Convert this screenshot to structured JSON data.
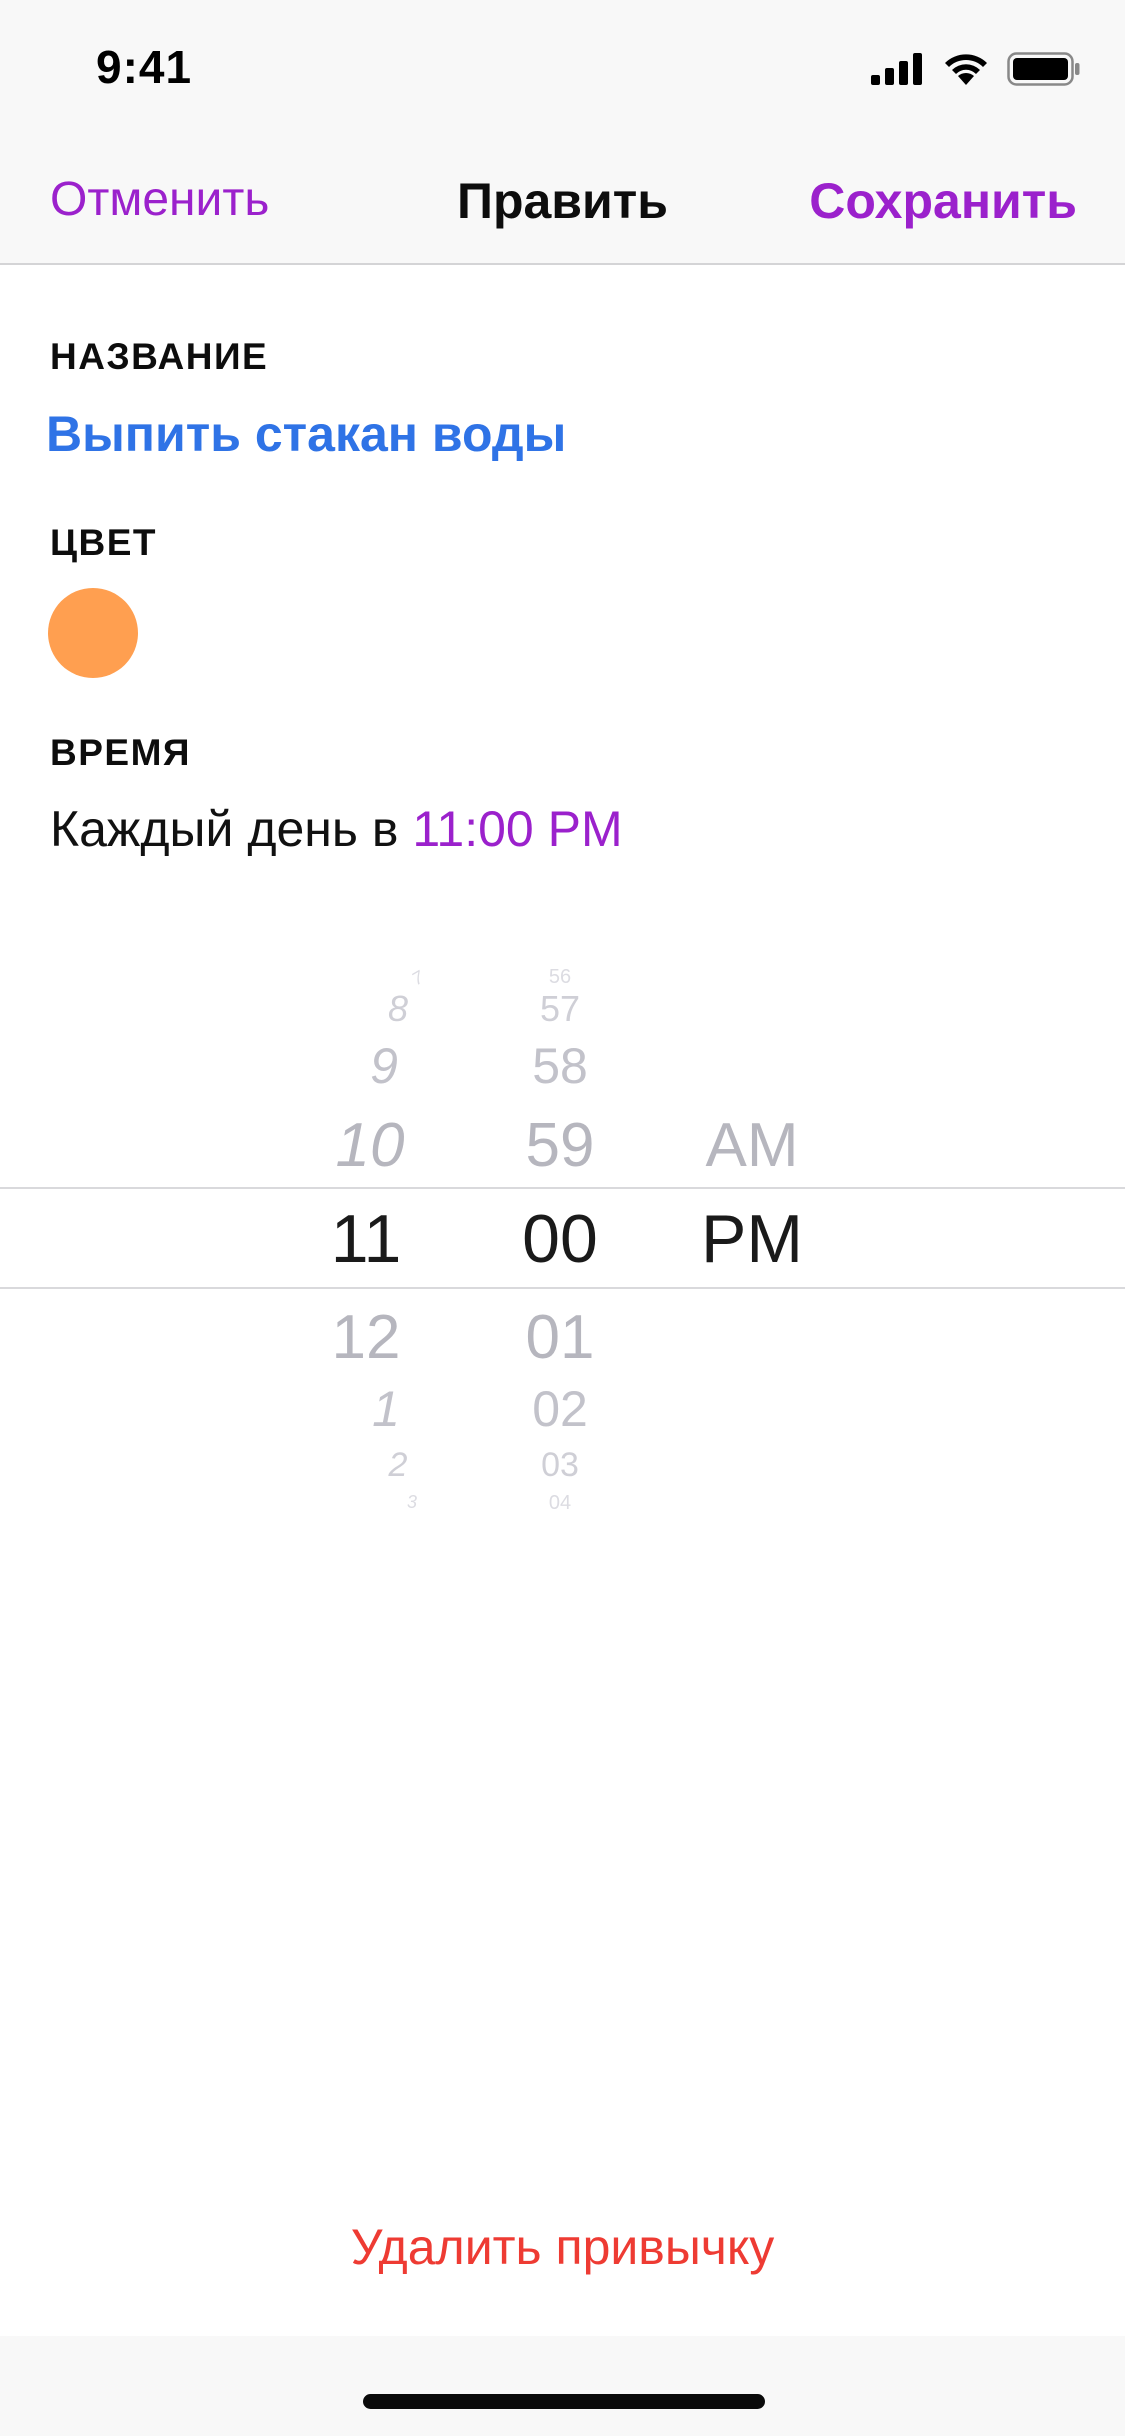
{
  "status": {
    "time": "9:41"
  },
  "nav": {
    "cancel_label": "Отменить",
    "title": "Править",
    "save_label": "Сохранить"
  },
  "form": {
    "name_label": "НАЗВАНИЕ",
    "name_value": "Выпить стакан воды",
    "color_label": "ЦВЕТ",
    "color_value": "#FF9F50",
    "time_label": "ВРЕМЯ",
    "time_prefix": "Каждый день в ",
    "time_value": "11:00 PM"
  },
  "picker": {
    "hours": [
      "7",
      "8",
      "9",
      "10",
      "11",
      "12",
      "1",
      "2",
      "3"
    ],
    "minutes": [
      "56",
      "57",
      "58",
      "59",
      "00",
      "01",
      "02",
      "03",
      "04"
    ],
    "periods": [
      "AM",
      "PM"
    ],
    "selected_hour": "11",
    "selected_minute": "00",
    "selected_period": "PM"
  },
  "actions": {
    "delete_label": "Удалить привычку"
  },
  "colors": {
    "accent": "#9B21CC",
    "name_text": "#2F73E6",
    "destructive": "#EE3B33"
  }
}
